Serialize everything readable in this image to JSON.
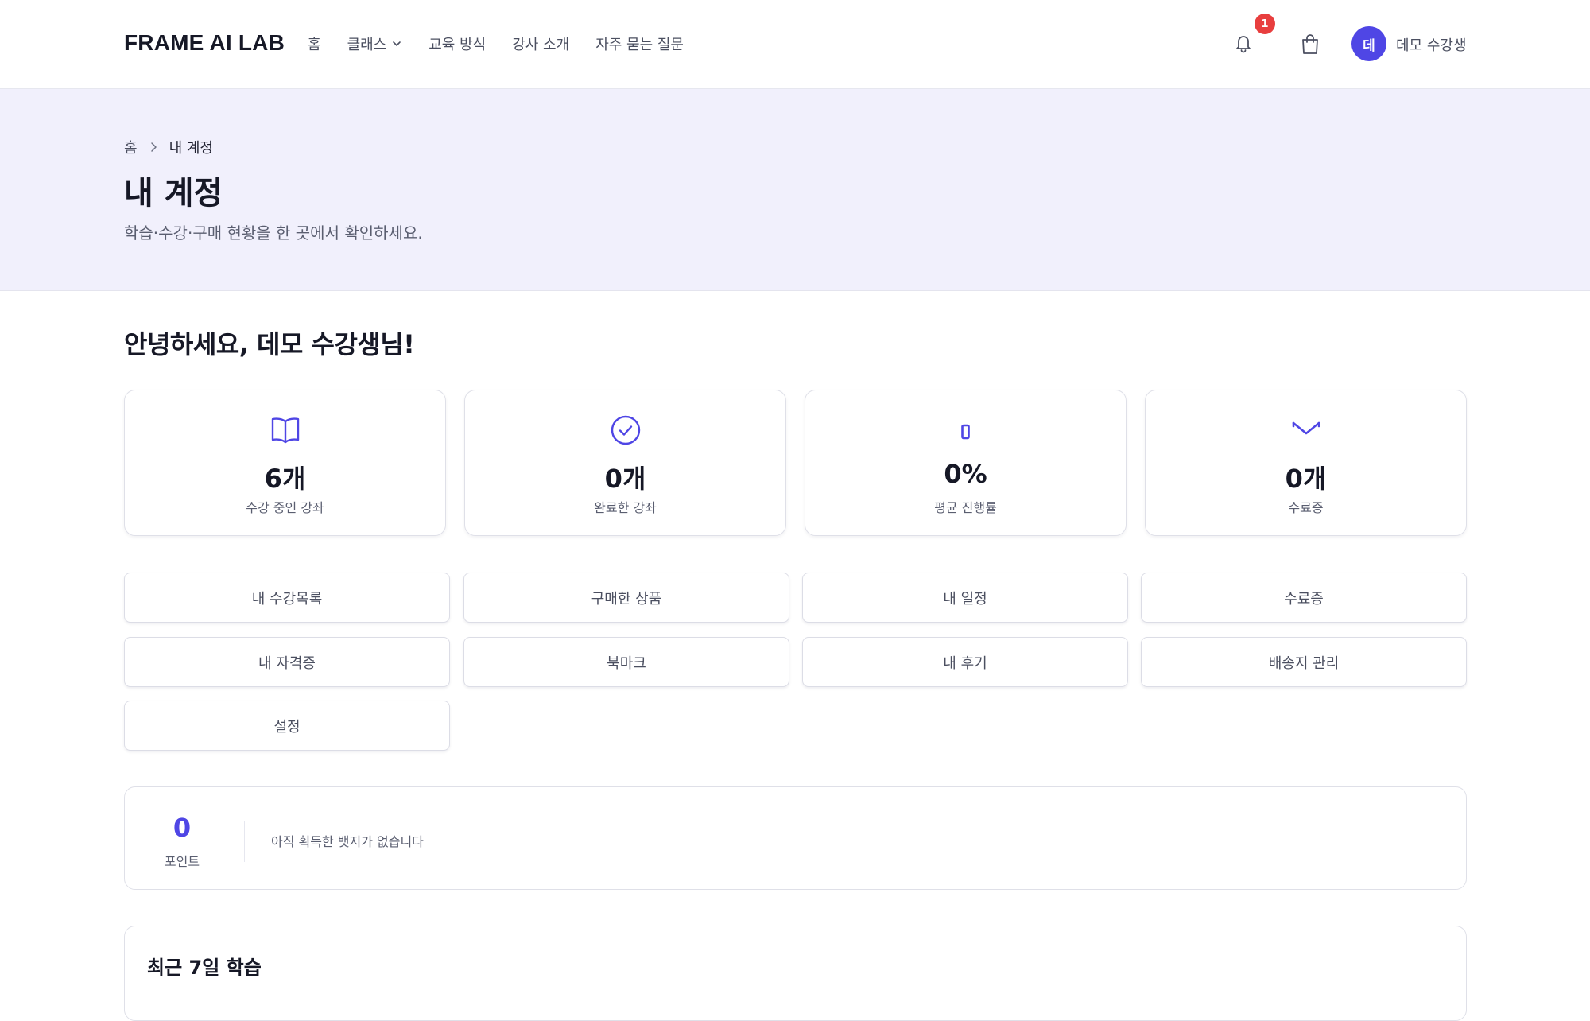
{
  "header": {
    "logo": "FRAME AI LAB",
    "nav": [
      "홈",
      "클래스",
      "교육 방식",
      "강사 소개",
      "자주 묻는 질문"
    ],
    "notification_count": "1",
    "avatar_initial": "데",
    "user_name": "데모 수강생"
  },
  "hero": {
    "breadcrumb_home": "홈",
    "breadcrumb_current": "내 계정",
    "title": "내 계정",
    "subtitle": "학습·수강·구매 현황을 한 곳에서 확인하세요."
  },
  "greeting": "안녕하세요, 데모 수강생님!",
  "stats": [
    {
      "icon": "book-open-icon",
      "value": "6개",
      "label": "수강 중인 강좌"
    },
    {
      "icon": "check-circle-icon",
      "value": "0개",
      "label": "완료한 강좌"
    },
    {
      "icon": "progress-bar-icon",
      "value": "0%",
      "label": "평균 진행률"
    },
    {
      "icon": "certificate-icon",
      "value": "0개",
      "label": "수료증"
    }
  ],
  "actions": [
    "내 수강목록",
    "구매한 상품",
    "내 일정",
    "수료증",
    "내 자격증",
    "북마크",
    "내 후기",
    "배송지 관리",
    "설정"
  ],
  "points": {
    "value": "0",
    "label": "포인트",
    "badges_empty": "아직 획득한 뱃지가 없습니다"
  },
  "recent": {
    "title": "최근 7일 학습"
  },
  "colors": {
    "accent": "#4f46e5",
    "badge_red": "#e83e3e",
    "hero_bg": "#f1f0fc"
  }
}
